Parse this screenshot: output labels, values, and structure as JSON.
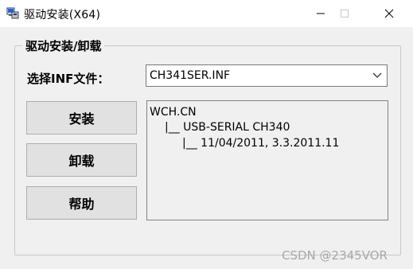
{
  "window": {
    "title": "驱动安装(X64)",
    "icons": {
      "app": "computer-setup-icon",
      "minimize": "minimize-icon",
      "maximize": "maximize-icon",
      "close": "close-icon"
    }
  },
  "group": {
    "label": "驱动安装/卸载"
  },
  "inf": {
    "label": "选择INF文件：",
    "selected": "CH341SER.INF",
    "arrow_icon": "chevron-down-icon"
  },
  "buttons": {
    "install": "安装",
    "uninstall": "卸载",
    "help": "帮助"
  },
  "info": {
    "line1": "WCH.CN",
    "line2": "|__ USB-SERIAL CH340",
    "line3": "|__ 11/04/2011, 3.3.2011.11"
  },
  "watermark": "CSDN @2345VOR"
}
